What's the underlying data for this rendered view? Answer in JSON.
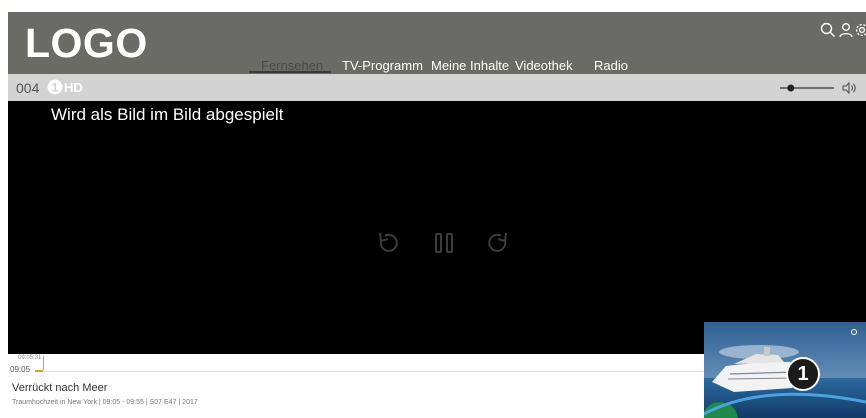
{
  "header": {
    "logo": "LOGO",
    "nav": [
      {
        "label": "Fernsehen",
        "active": true
      },
      {
        "label": "TV-Programm",
        "active": false
      },
      {
        "label": "Meine Inhalte",
        "active": false
      },
      {
        "label": "Videothek",
        "active": false
      },
      {
        "label": "Radio",
        "active": false
      }
    ],
    "icons": [
      "search-icon",
      "user-icon",
      "gear-icon"
    ]
  },
  "channel": {
    "number": "004",
    "logo_icon": "das-erste-hd-logo"
  },
  "volume": {
    "level": 0.2
  },
  "player": {
    "message": "Wird als Bild im Bild abgespielt",
    "controls": [
      "rewind-icon",
      "pause-icon",
      "forward-icon"
    ]
  },
  "progress": {
    "marker_time": "09:05:31",
    "start_time": "09:05",
    "fraction": 0.01
  },
  "show": {
    "title": "Verrückt nach Meer",
    "meta": "Traumhochzeit in New York | 09:05 - 09:55 | S07 E47 | 2017"
  },
  "pip": {
    "badge": "1"
  }
}
